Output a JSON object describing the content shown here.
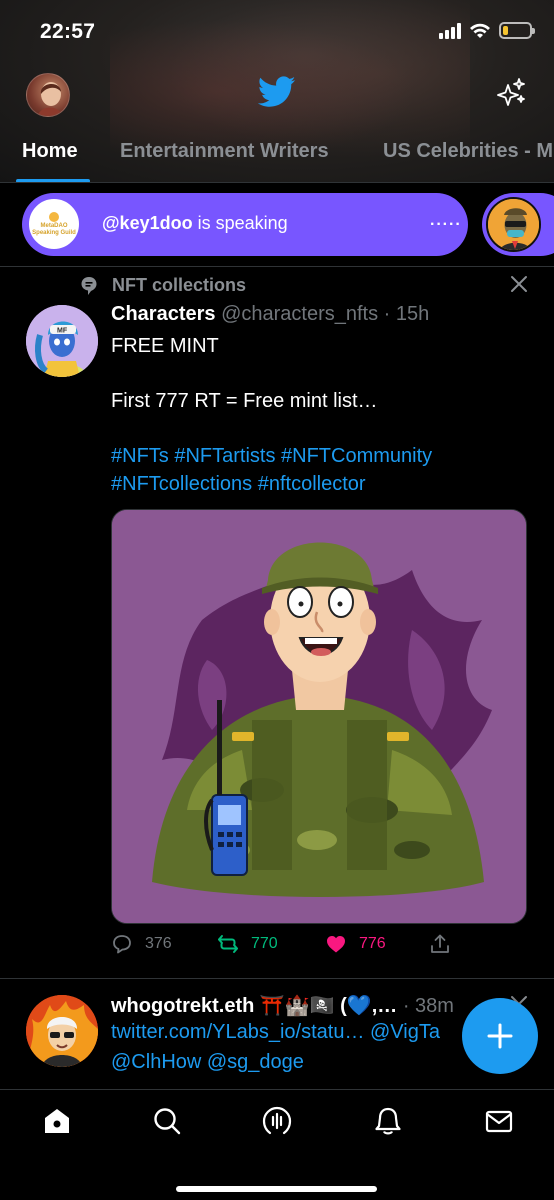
{
  "status_bar": {
    "time": "22:57",
    "battery_level": 0.18,
    "battery_color": "#f5c430"
  },
  "header": {
    "tabs": [
      {
        "label": "Home",
        "active": true
      },
      {
        "label": "Entertainment Writers",
        "active": false
      },
      {
        "label": "US Celebrities - M",
        "active": false
      }
    ],
    "icons": {
      "profile": "avatar",
      "logo": "twitter-bird-icon",
      "sparkle": "sparkle-icon"
    }
  },
  "spaces": {
    "speaker_handle": "@key1doo",
    "speaker_suffix": " is speaking",
    "more_indicator": "·····",
    "host_badge": {
      "line1": "MetaDAO",
      "line2": "Speaking Guild"
    },
    "accent": "#7856ff"
  },
  "tweet1": {
    "social_context": "NFT collections",
    "name": "Characters",
    "handle": "@characters_nfts",
    "separator": " · ",
    "time": "15h",
    "text_lines": [
      "FREE MINT",
      "",
      "First 777 RT = Free mint list…",
      ""
    ],
    "hashtag_line1": "#NFTs #NFTartists  #NFTCommunity",
    "hashtag_line2": "#NFTcollections #nftcollector",
    "stats": {
      "replies": "376",
      "retweets": "770",
      "likes": "776"
    },
    "liked": true
  },
  "tweet2": {
    "name_line": "whogotrekt.eth ⛩️🏰🏴‍☠️ (💙,…",
    "time": "· 38m",
    "link_line": "twitter.com/YLabs_io/statu… @VigTa",
    "mention_line": "@ClhHow @sg_doge"
  },
  "colors": {
    "brand": "#1d9bf0",
    "retweet": "#00ba7c",
    "like": "#f91880",
    "muted": "#71767b"
  },
  "nav": [
    "home-icon",
    "search-icon",
    "spaces-icon",
    "notifications-icon",
    "messages-icon"
  ]
}
